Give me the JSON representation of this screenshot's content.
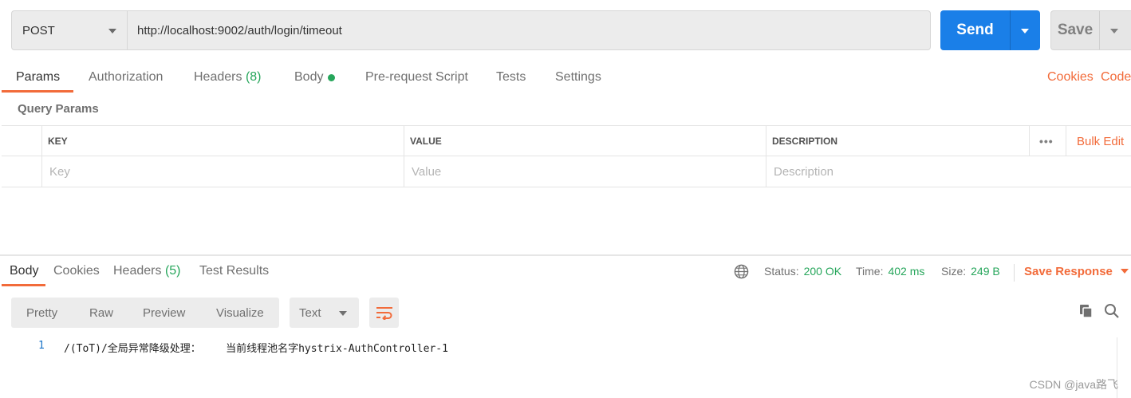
{
  "request": {
    "method": "POST",
    "url": "http://localhost:9002/auth/login/timeout",
    "send_label": "Send",
    "save_label": "Save"
  },
  "request_tabs": {
    "params": "Params",
    "authorization": "Authorization",
    "headers": "Headers",
    "headers_count": "(8)",
    "body": "Body",
    "prerequest": "Pre-request Script",
    "tests": "Tests",
    "settings": "Settings",
    "cookies": "Cookies",
    "code": "Code"
  },
  "query_params": {
    "title": "Query Params",
    "columns": {
      "key": "KEY",
      "value": "VALUE",
      "description": "DESCRIPTION"
    },
    "more": "•••",
    "bulk_edit": "Bulk Edit",
    "placeholders": {
      "key": "Key",
      "value": "Value",
      "description": "Description"
    }
  },
  "response_tabs": {
    "body": "Body",
    "cookies": "Cookies",
    "headers": "Headers",
    "headers_count": "(5)",
    "test_results": "Test Results"
  },
  "status": {
    "status_label": "Status:",
    "status_value": "200 OK",
    "time_label": "Time:",
    "time_value": "402 ms",
    "size_label": "Size:",
    "size_value": "249 B",
    "save_response": "Save Response"
  },
  "response_view": {
    "pretty": "Pretty",
    "raw": "Raw",
    "preview": "Preview",
    "visualize": "Visualize",
    "format": "Text"
  },
  "response_body": {
    "line_number": "1",
    "text": "/(ToT)/全局异常降级处理：    当前线程池名字hystrix-AuthController-1"
  },
  "watermark": "CSDN @java路飞",
  "colors": {
    "accent": "#f26b3a",
    "send": "#1a7fe8",
    "success": "#26a65b"
  }
}
